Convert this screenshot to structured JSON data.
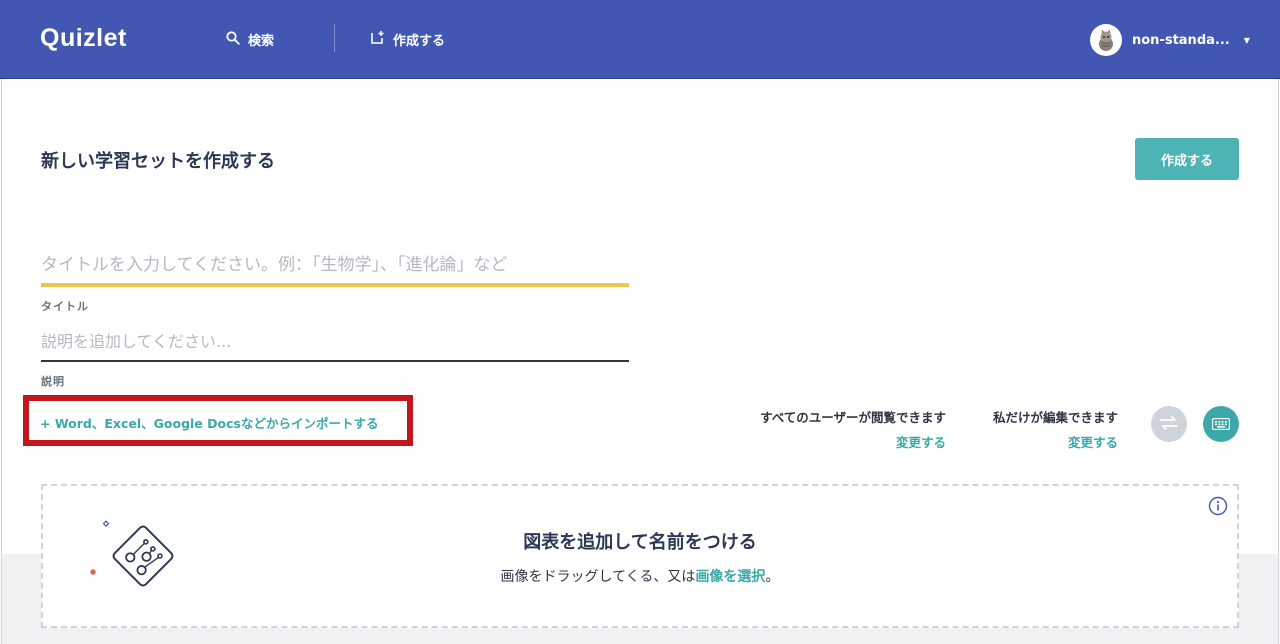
{
  "header": {
    "logo": "Quizlet",
    "search_label": "検索",
    "create_label": "作成する",
    "username": "non-standa...",
    "colors": {
      "background": "#4257b2"
    }
  },
  "main": {
    "page_title": "新しい学習セットを作成する",
    "create_button": "作成する",
    "title_field": {
      "placeholder": "タイトルを入力してください。例：「生物学」、「進化論」など",
      "value": "",
      "label": "タイトル"
    },
    "description_field": {
      "placeholder": "説明を追加してください...",
      "value": "",
      "label": "説明"
    },
    "import_link": "+ Word、Excel、Google Docsなどからインポートする",
    "privacy": {
      "view_text": "すべてのユーザーが閲覧できます",
      "view_change": "変更する",
      "edit_text": "私だけが編集できます",
      "edit_change": "変更する"
    },
    "diagram": {
      "title": "図表を追加して名前をつける",
      "subtitle_prefix": "画像をドラッグしてくる、又は",
      "subtitle_link": "画像を選択",
      "subtitle_suffix": "。"
    }
  },
  "colors": {
    "accent": "#3ca8a9",
    "title_underline": "#f0c54d",
    "highlight_box": "#c2151c"
  },
  "icons": [
    "search-icon",
    "create-set-icon",
    "avatar",
    "caret-down-icon",
    "swap-icon",
    "keyboard-icon",
    "info-icon",
    "diagram-illustration"
  ]
}
